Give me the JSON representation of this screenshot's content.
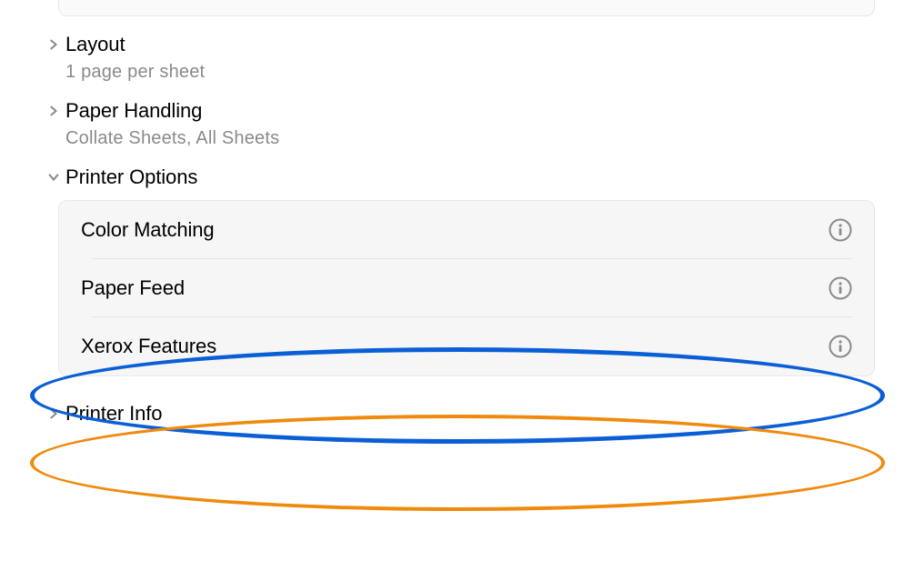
{
  "sections": {
    "layout": {
      "title": "Layout",
      "subtitle": "1 page per sheet"
    },
    "paper_handling": {
      "title": "Paper Handling",
      "subtitle": "Collate Sheets, All Sheets"
    },
    "printer_options": {
      "title": "Printer Options",
      "items": [
        {
          "label": "Color Matching"
        },
        {
          "label": "Paper Feed"
        },
        {
          "label": "Xerox Features"
        }
      ]
    },
    "printer_info": {
      "title": "Printer Info"
    }
  }
}
